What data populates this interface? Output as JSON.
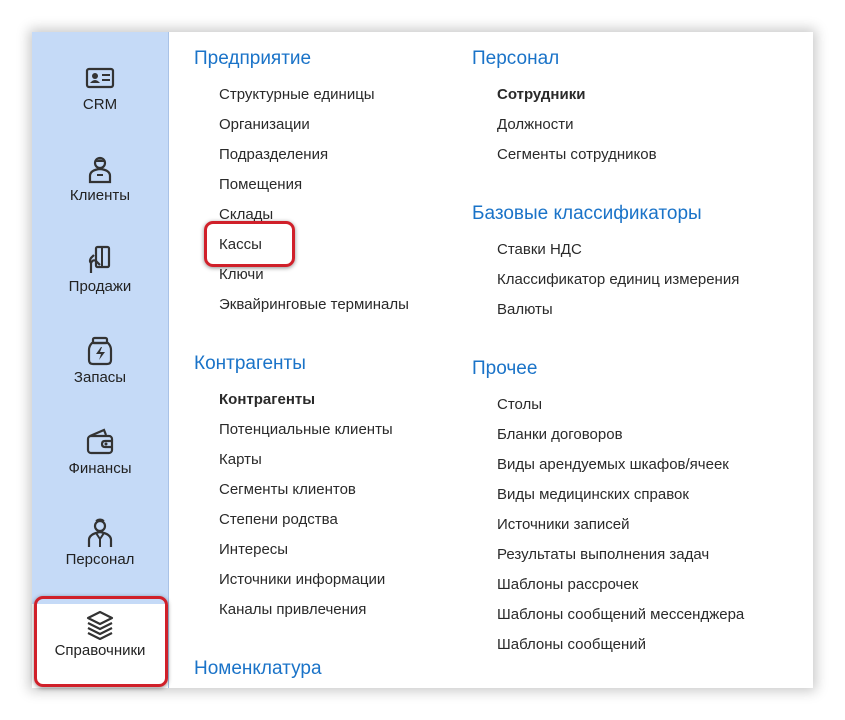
{
  "sidebar": {
    "items": [
      {
        "label": "CRM",
        "icon": "contact-card-icon"
      },
      {
        "label": "Клиенты",
        "icon": "client-person-icon"
      },
      {
        "label": "Продажи",
        "icon": "sales-hand-card-icon"
      },
      {
        "label": "Запасы",
        "icon": "stock-jar-icon"
      },
      {
        "label": "Финансы",
        "icon": "wallet-icon"
      },
      {
        "label": "Персонал",
        "icon": "staff-person-icon"
      },
      {
        "label": "Справочники",
        "icon": "stack-layers-icon"
      }
    ],
    "active": "Справочники"
  },
  "sections": {
    "enterprise": {
      "title": "Предприятие",
      "links": [
        "Структурные единицы",
        "Организации",
        "Подразделения",
        "Помещения",
        "Склады",
        "Кассы",
        "Ключи",
        "Эквайринговые терминалы"
      ]
    },
    "contractors": {
      "title": "Контрагенты",
      "links": [
        "Контрагенты",
        "Потенциальные клиенты",
        "Карты",
        "Сегменты клиентов",
        "Степени родства",
        "Интересы",
        "Источники информации",
        "Каналы привлечения"
      ]
    },
    "nomenclature": {
      "title": "Номенклатура"
    },
    "personnel": {
      "title": "Персонал",
      "links": [
        "Сотрудники",
        "Должности",
        "Сегменты сотрудников"
      ]
    },
    "base_classifiers": {
      "title": "Базовые классификаторы",
      "links": [
        "Ставки НДС",
        "Классификатор единиц измерения",
        "Валюты"
      ]
    },
    "other": {
      "title": "Прочее",
      "links": [
        "Столы",
        "Бланки договоров",
        "Виды арендуемых шкафов/ячеек",
        "Виды медицинских справок",
        "Источники записей",
        "Результаты выполнения задач",
        "Шаблоны рассрочек",
        "Шаблоны сообщений мессенджера",
        "Шаблоны сообщений"
      ]
    }
  },
  "colors": {
    "sidebar_bg": "#c5daf7",
    "section_title": "#1a73c8",
    "highlight": "#d0202a"
  }
}
